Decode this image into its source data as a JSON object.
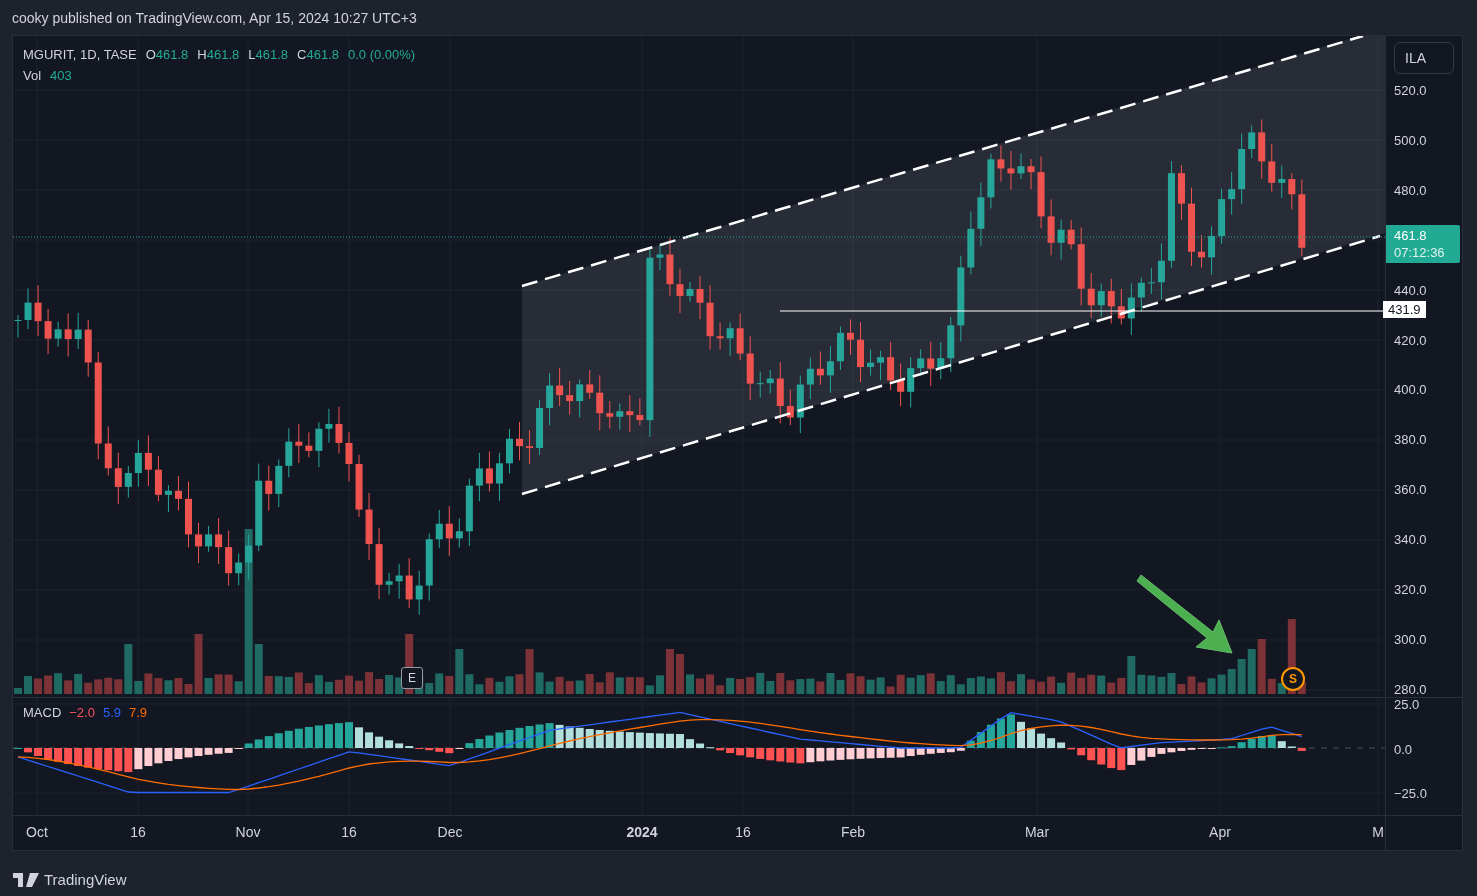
{
  "header": {
    "caption": "cooky published on TradingView.com, Apr 15, 2024 10:27 UTC+3"
  },
  "legend": {
    "symbol": "MGURIT, 1D, TASE",
    "ohlc": [
      {
        "label": "O",
        "value": "461.8"
      },
      {
        "label": "H",
        "value": "461.8"
      },
      {
        "label": "L",
        "value": "461.8"
      },
      {
        "label": "C",
        "value": "461.8"
      }
    ],
    "change": "0.0 (0.00%)",
    "volume_label": "Vol",
    "volume_value": "403"
  },
  "price_axis": {
    "currency": "ILA",
    "ticks_above": [
      "520.0",
      "500.0",
      "480.0"
    ],
    "ticks_below": [
      "440.0",
      "420.0",
      "400.0",
      "380.0",
      "360.0",
      "340.0",
      "320.0",
      "300.0",
      "280.0"
    ],
    "last_price": "461.8",
    "countdown": "07:12:36",
    "level_label": "431.9"
  },
  "markers": [
    {
      "kind": "square",
      "label": "E"
    },
    {
      "kind": "circle",
      "label": "S"
    }
  ],
  "macd": {
    "label": "MACD",
    "values": [
      {
        "value": "−2.0",
        "color": "#f7525f"
      },
      {
        "value": "5.9",
        "color": "#2962ff"
      },
      {
        "value": "7.9",
        "color": "#ff6d00"
      }
    ],
    "ticks": [
      "25.0",
      "0.0",
      "−25.0"
    ]
  },
  "time_axis": {
    "labels": [
      {
        "text": "Oct",
        "bold": false
      },
      {
        "text": "16",
        "bold": false
      },
      {
        "text": "Nov",
        "bold": false
      },
      {
        "text": "16",
        "bold": false
      },
      {
        "text": "Dec",
        "bold": false
      },
      {
        "text": "2024",
        "bold": true
      },
      {
        "text": "16",
        "bold": false
      },
      {
        "text": "Feb",
        "bold": false
      },
      {
        "text": "Mar",
        "bold": false
      },
      {
        "text": "Apr",
        "bold": false
      },
      {
        "text": "M",
        "bold": false
      }
    ]
  },
  "footer": {
    "brand": "TradingView"
  }
}
